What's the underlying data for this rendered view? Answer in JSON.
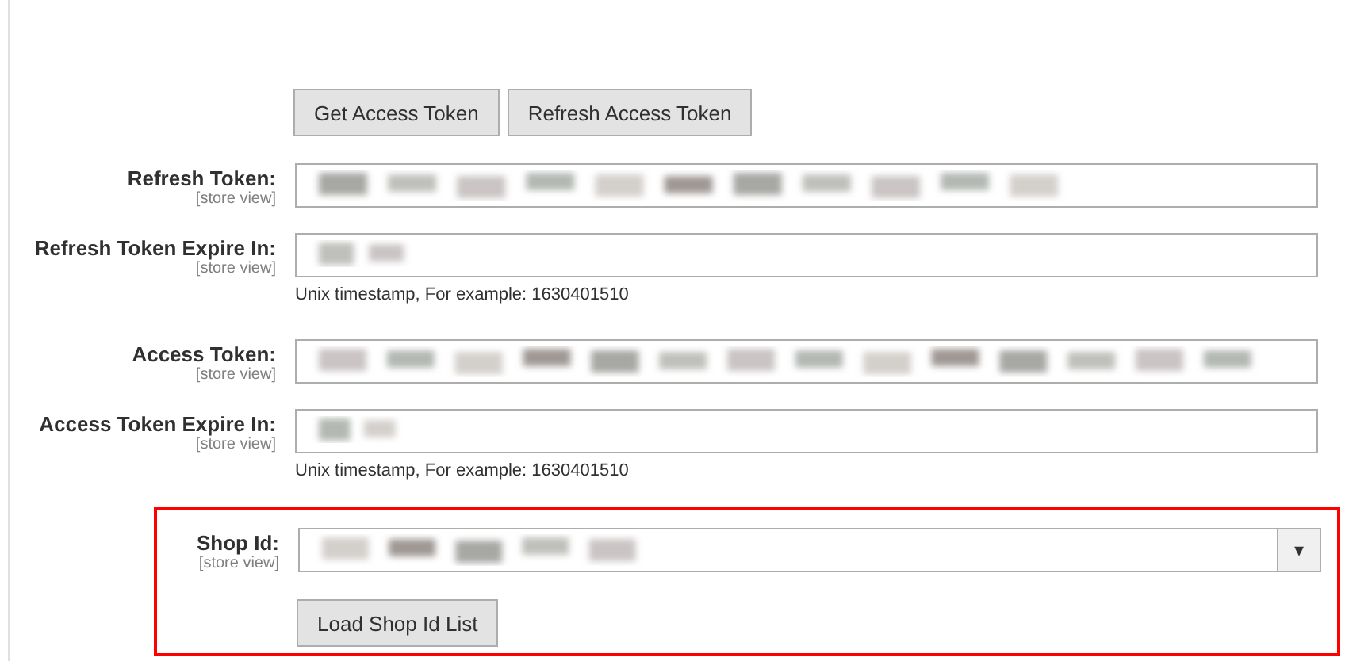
{
  "actions": {
    "buttons": [
      {
        "label": "Get Access Token"
      },
      {
        "label": "Refresh Access Token"
      }
    ]
  },
  "fields": [
    {
      "kind": "text",
      "label": "Refresh Token:",
      "scope": "[store view]",
      "redacted": true
    },
    {
      "kind": "text",
      "label": "Refresh Token Expire In:",
      "scope": "[store view]",
      "redacted": true,
      "note": "Unix timestamp, For example: 1630401510"
    },
    {
      "kind": "text",
      "label": "Access Token:",
      "scope": "[store view]",
      "redacted": true
    },
    {
      "kind": "text",
      "label": "Access Token Expire In:",
      "scope": "[store view]",
      "redacted": true,
      "note": "Unix timestamp, For example: 1630401510"
    }
  ],
  "shop_section": {
    "highlighted": true,
    "field": {
      "kind": "select",
      "label": "Shop Id:",
      "scope": "[store view]",
      "redacted": true,
      "arrow": "▾"
    },
    "button": {
      "label": "Load Shop Id List"
    }
  }
}
